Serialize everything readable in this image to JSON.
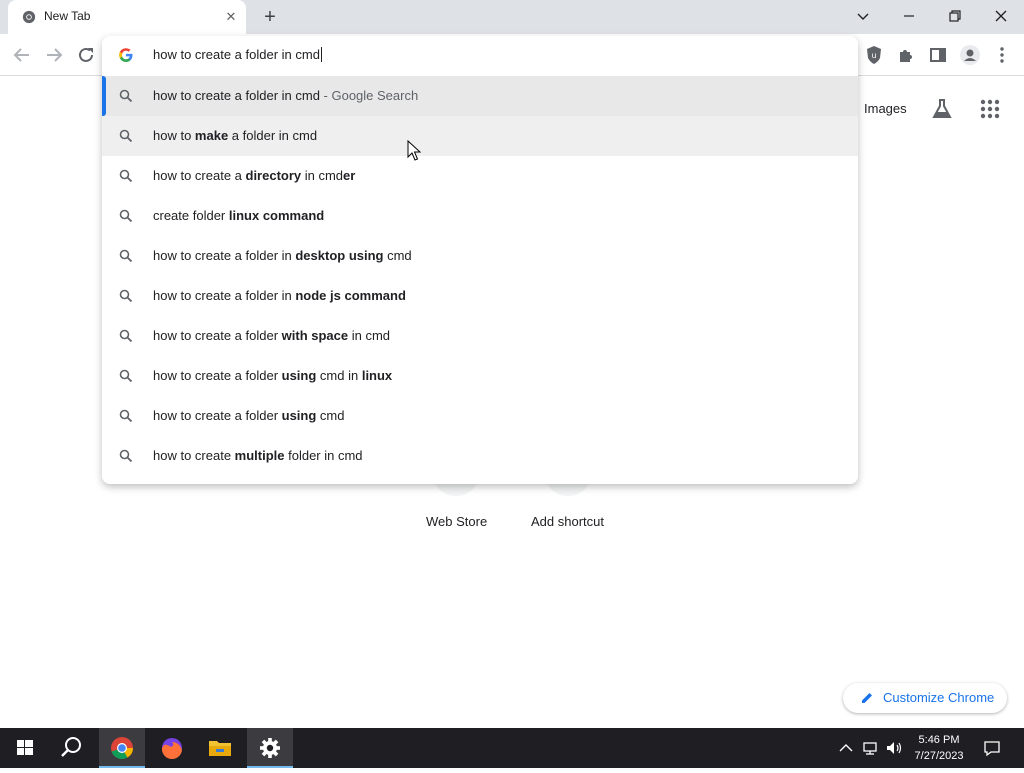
{
  "tab": {
    "title": "New Tab",
    "close_icon": "close-icon"
  },
  "newtab_icon": "plus-icon",
  "window": {
    "controls": [
      "tab-search",
      "minimize",
      "restore",
      "close"
    ]
  },
  "omnibox": {
    "text": "how to create a folder in cmd",
    "suggestions": [
      {
        "parts": [
          {
            "t": "how to create a folder in cmd",
            "b": false
          },
          {
            "t": " - Google Search",
            "b": false,
            "dim": true
          }
        ],
        "selected": true
      },
      {
        "parts": [
          {
            "t": "how to ",
            "b": false
          },
          {
            "t": "make",
            "b": true
          },
          {
            "t": " a folder in cmd",
            "b": false
          }
        ],
        "hovered": true
      },
      {
        "parts": [
          {
            "t": "how to create a ",
            "b": false
          },
          {
            "t": "directory",
            "b": true
          },
          {
            "t": " in cmd",
            "b": false
          },
          {
            "t": "er",
            "b": true
          }
        ]
      },
      {
        "parts": [
          {
            "t": "create folder ",
            "b": false
          },
          {
            "t": "linux command",
            "b": true
          }
        ]
      },
      {
        "parts": [
          {
            "t": "how to create a folder in ",
            "b": false
          },
          {
            "t": "desktop using",
            "b": true
          },
          {
            "t": " cmd",
            "b": false
          }
        ]
      },
      {
        "parts": [
          {
            "t": "how to create a folder in ",
            "b": false
          },
          {
            "t": "node js command",
            "b": true
          }
        ]
      },
      {
        "parts": [
          {
            "t": "how to create a folder ",
            "b": false
          },
          {
            "t": "with space",
            "b": true
          },
          {
            "t": " in cmd",
            "b": false
          }
        ]
      },
      {
        "parts": [
          {
            "t": "how to create a folder ",
            "b": false
          },
          {
            "t": "using",
            "b": true
          },
          {
            "t": " cmd in ",
            "b": false
          },
          {
            "t": "linux",
            "b": true
          }
        ]
      },
      {
        "parts": [
          {
            "t": "how to create a folder ",
            "b": false
          },
          {
            "t": "using",
            "b": true
          },
          {
            "t": " cmd",
            "b": false
          }
        ]
      },
      {
        "parts": [
          {
            "t": "how to create ",
            "b": false
          },
          {
            "t": "multiple",
            "b": true
          },
          {
            "t": " folder in cmd",
            "b": false
          }
        ]
      }
    ]
  },
  "ntp": {
    "images_link": "Images",
    "shortcuts": [
      "Web Store",
      "Add shortcut"
    ],
    "customize_label": "Customize Chrome"
  },
  "taskbar": {
    "apps": [
      "start",
      "search",
      "chrome",
      "firefox",
      "file-explorer",
      "settings"
    ],
    "time": "5:46 PM",
    "date": "7/27/2023"
  },
  "colors": {
    "accent": "#1a73e8",
    "tabstrip": "#dee1e6",
    "taskbar": "#1f1f23"
  }
}
